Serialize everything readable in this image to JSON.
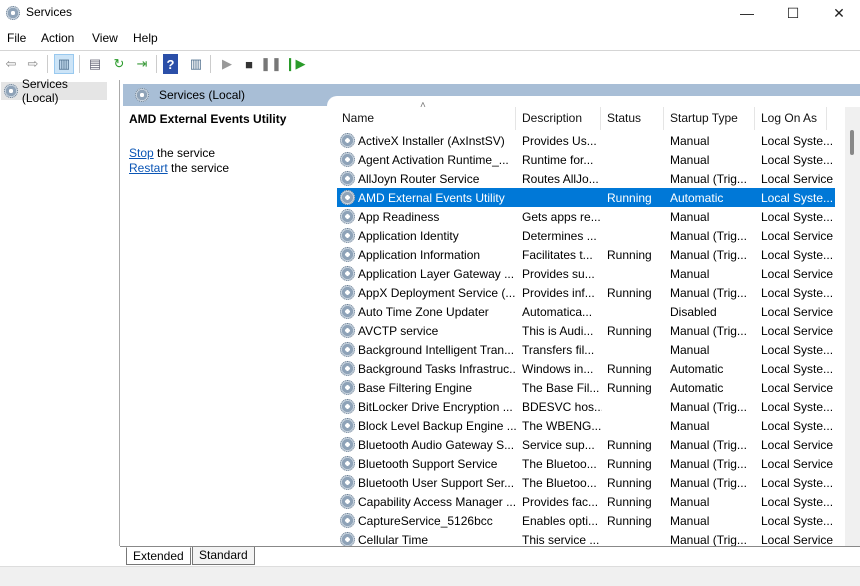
{
  "window": {
    "title": "Services",
    "minimize": "—",
    "maximize": "☐",
    "close": "✕"
  },
  "menu": [
    "File",
    "Action",
    "View",
    "Help"
  ],
  "toolbar": {
    "icons": [
      "back-icon",
      "forward-icon",
      "show-hide-tree-icon",
      "properties-icon",
      "refresh-icon",
      "export-list-icon",
      "help-icon",
      "show-hide-action-pane-icon",
      "start-service-icon",
      "stop-service-icon",
      "pause-service-icon",
      "restart-service-icon"
    ]
  },
  "tree": {
    "root": "Services (Local)"
  },
  "pane": {
    "header": "Services (Local)"
  },
  "extended": {
    "service_name": "AMD External Events Utility",
    "stop_link": "Stop",
    "stop_suffix": " the service",
    "restart_link": "Restart",
    "restart_suffix": " the service"
  },
  "columns": [
    "Name",
    "Description",
    "Status",
    "Startup Type",
    "Log On As"
  ],
  "rows": [
    [
      "ActiveX Installer (AxInstSV)",
      "Provides Us...",
      "",
      "Manual",
      "Local Syste..."
    ],
    [
      "Agent Activation Runtime_...",
      "Runtime for...",
      "",
      "Manual",
      "Local Syste..."
    ],
    [
      "AllJoyn Router Service",
      "Routes AllJo...",
      "",
      "Manual (Trig...",
      "Local Service"
    ],
    [
      "AMD External Events Utility",
      "",
      "Running",
      "Automatic",
      "Local Syste..."
    ],
    [
      "App Readiness",
      "Gets apps re...",
      "",
      "Manual",
      "Local Syste..."
    ],
    [
      "Application Identity",
      "Determines ...",
      "",
      "Manual (Trig...",
      "Local Service"
    ],
    [
      "Application Information",
      "Facilitates t...",
      "Running",
      "Manual (Trig...",
      "Local Syste..."
    ],
    [
      "Application Layer Gateway ...",
      "Provides su...",
      "",
      "Manual",
      "Local Service"
    ],
    [
      "AppX Deployment Service (...",
      "Provides inf...",
      "Running",
      "Manual (Trig...",
      "Local Syste..."
    ],
    [
      "Auto Time Zone Updater",
      "Automatica...",
      "",
      "Disabled",
      "Local Service"
    ],
    [
      "AVCTP service",
      "This is Audi...",
      "Running",
      "Manual (Trig...",
      "Local Service"
    ],
    [
      "Background Intelligent Tran...",
      "Transfers fil...",
      "",
      "Manual",
      "Local Syste..."
    ],
    [
      "Background Tasks Infrastruc...",
      "Windows in...",
      "Running",
      "Automatic",
      "Local Syste..."
    ],
    [
      "Base Filtering Engine",
      "The Base Fil...",
      "Running",
      "Automatic",
      "Local Service"
    ],
    [
      "BitLocker Drive Encryption ...",
      "BDESVC hos...",
      "",
      "Manual (Trig...",
      "Local Syste..."
    ],
    [
      "Block Level Backup Engine ...",
      "The WBENG...",
      "",
      "Manual",
      "Local Syste..."
    ],
    [
      "Bluetooth Audio Gateway S...",
      "Service sup...",
      "Running",
      "Manual (Trig...",
      "Local Service"
    ],
    [
      "Bluetooth Support Service",
      "The Bluetoo...",
      "Running",
      "Manual (Trig...",
      "Local Service"
    ],
    [
      "Bluetooth User Support Ser...",
      "The Bluetoo...",
      "Running",
      "Manual (Trig...",
      "Local Syste..."
    ],
    [
      "Capability Access Manager ...",
      "Provides fac...",
      "Running",
      "Manual",
      "Local Syste..."
    ],
    [
      "CaptureService_5126bcc",
      "Enables opti...",
      "Running",
      "Manual",
      "Local Syste..."
    ],
    [
      "Cellular Time",
      "This service ...",
      "",
      "Manual (Trig...",
      "Local Service"
    ]
  ],
  "selected_row": 3,
  "tabs": [
    "Extended",
    "Standard"
  ],
  "colors": {
    "selection": "#0078d7",
    "pane_header": "#a8bed6"
  }
}
